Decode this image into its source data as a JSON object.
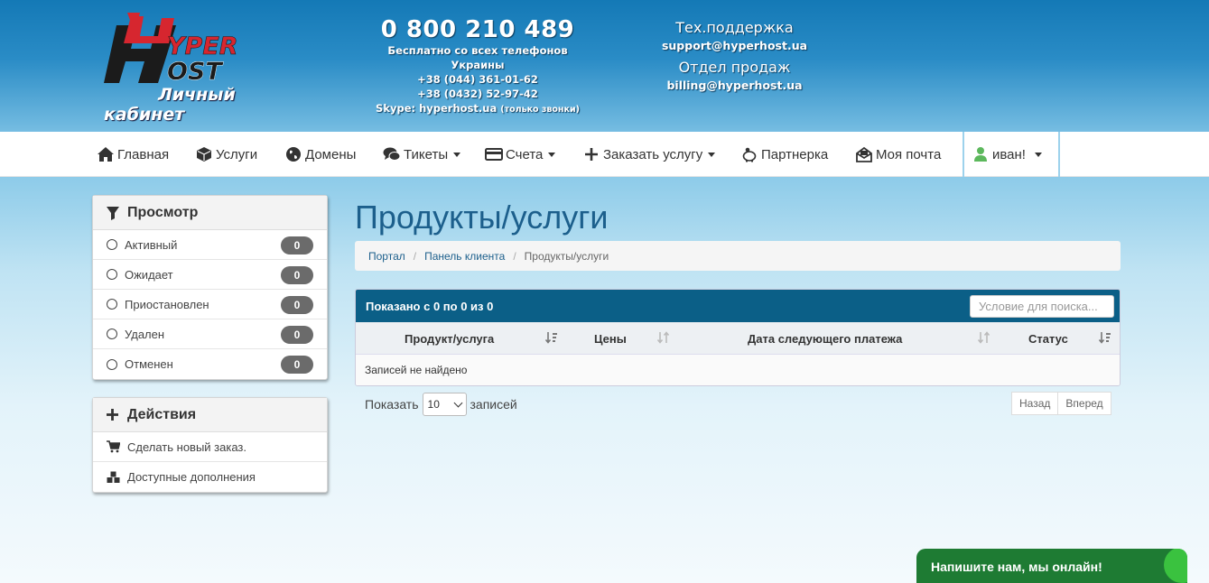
{
  "header": {
    "logo": {
      "text_top": "YPER",
      "text_bottom": "OST",
      "caption_line1": "Личный",
      "caption_line2": "кабинет"
    },
    "phone": {
      "main": "0 800 210 489",
      "free_note": "Бесплатно со всех телефонов Украины",
      "phone2": "+38 (044) 361-01-62",
      "phone3": "+38 (0432) 52-97-42",
      "skype": "Skype: hyperhost.ua",
      "skype_note": "(только звонки)"
    },
    "support": {
      "title": "Тех.поддержка",
      "email": "support@hyperhost.ua",
      "sales_title": "Отдел продаж",
      "sales_email": "billing@hyperhost.ua"
    }
  },
  "nav": {
    "home": "Главная",
    "services": "Услуги",
    "domains": "Домены",
    "tickets": "Тикеты",
    "invoices": "Счета",
    "order": "Заказать услугу",
    "partner": "Партнерка",
    "mail": "Моя почта",
    "user": "иван!"
  },
  "sidebar": {
    "view": {
      "title": "Просмотр",
      "filters": [
        {
          "label": "Активный",
          "count": "0"
        },
        {
          "label": "Ожидает",
          "count": "0"
        },
        {
          "label": "Приостановлен",
          "count": "0"
        },
        {
          "label": "Удален",
          "count": "0"
        },
        {
          "label": "Отменен",
          "count": "0"
        }
      ]
    },
    "actions": {
      "title": "Действия",
      "items": [
        {
          "label": "Сделать новый заказ."
        },
        {
          "label": "Доступные дополнения"
        }
      ]
    }
  },
  "main": {
    "title": "Продукты/услуги",
    "breadcrumb": [
      "Портал",
      "Панель клиента",
      "Продукты/услуги"
    ],
    "table": {
      "info": "Показано с 0 по 0 из 0",
      "search_placeholder": "Условие для поиска...",
      "columns": [
        "Продукт/услуга",
        "Цены",
        "Дата следующего платежа",
        "Статус"
      ],
      "empty": "Записей не найдено"
    },
    "length": {
      "label_before": "Показать",
      "value": "10",
      "label_after": "записей"
    },
    "pager": {
      "prev": "Назад",
      "next": "Вперед"
    }
  },
  "chat": {
    "label": "Напишите нам, мы онлайн!"
  },
  "colors": {
    "header_top": "#1479b6",
    "table_header": "#0b5f87",
    "title": "#1c5f8c",
    "badge": "#6b6b6b",
    "chat": "#1e7b33"
  }
}
